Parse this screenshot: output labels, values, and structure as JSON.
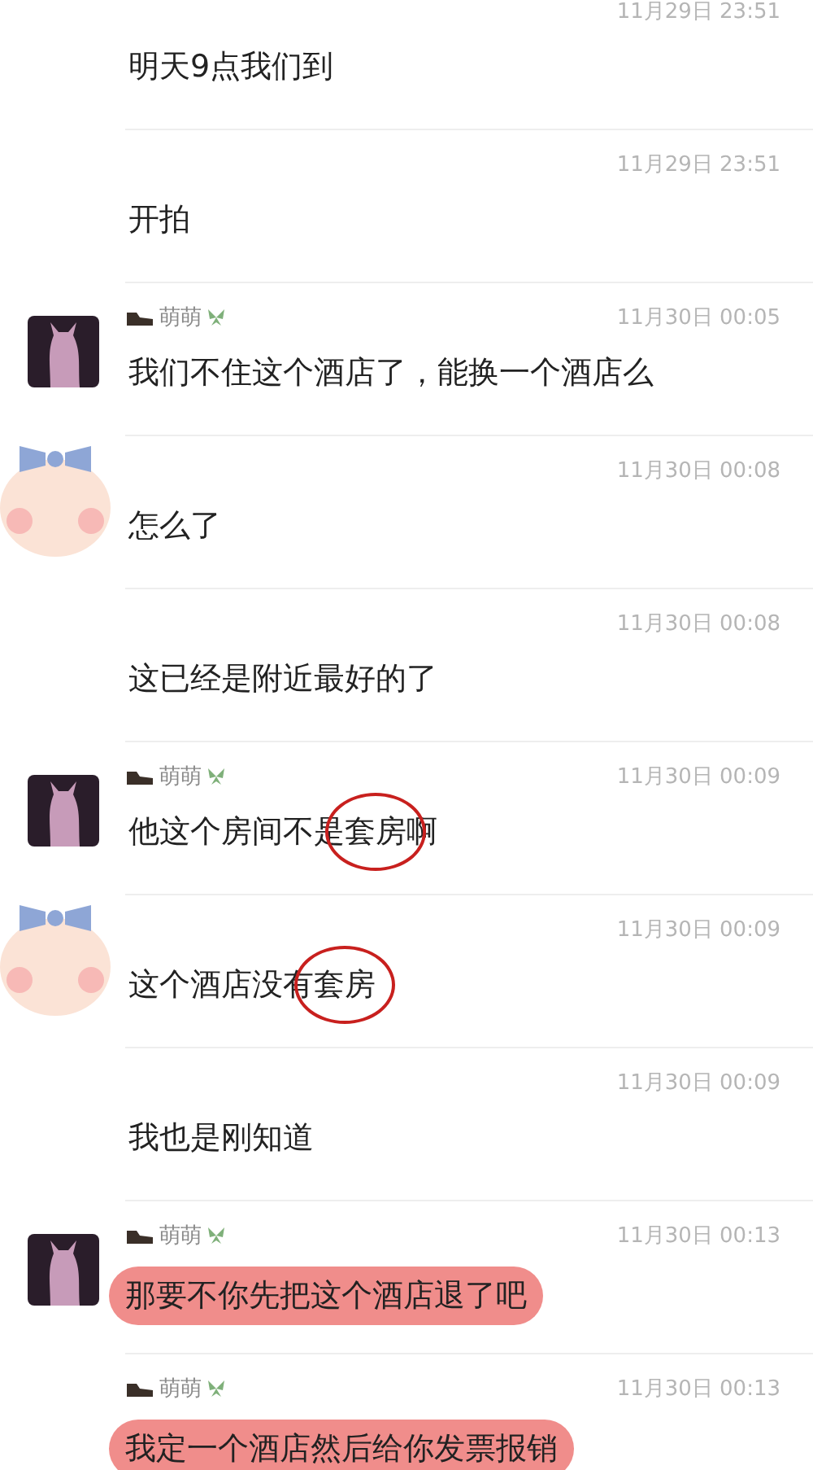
{
  "messages": [
    {
      "time": "11月29日 23:51",
      "highlighted": false,
      "segments": [
        {
          "text": "明天9点我们到",
          "circled": false
        }
      ]
    },
    {
      "time": "11月29日 23:51",
      "highlighted": false,
      "segments": [
        {
          "text": "开拍",
          "circled": false
        }
      ]
    },
    {
      "avatar": {
        "kind": "figure"
      },
      "name": "萌萌",
      "time": "11月30日 00:05",
      "highlighted": false,
      "segments": [
        {
          "text": "我们不住这个酒店了，能换一个酒店么",
          "circled": false
        }
      ]
    },
    {
      "avatar": {
        "kind": "bear"
      },
      "time": "11月30日 00:08",
      "highlighted": false,
      "segments": [
        {
          "text": "怎么了",
          "circled": false
        }
      ]
    },
    {
      "time": "11月30日 00:08",
      "highlighted": false,
      "segments": [
        {
          "text": "这已经是附近最好的了",
          "circled": false
        }
      ]
    },
    {
      "avatar": {
        "kind": "figure"
      },
      "name": "萌萌",
      "time": "11月30日 00:09",
      "highlighted": false,
      "segments": [
        {
          "text": "他这个房间不是",
          "circled": false
        },
        {
          "text": "套房",
          "circled": true
        },
        {
          "text": "啊",
          "circled": false
        }
      ]
    },
    {
      "avatar": {
        "kind": "bear"
      },
      "time": "11月30日 00:09",
      "highlighted": false,
      "segments": [
        {
          "text": "这个酒店没有",
          "circled": false
        },
        {
          "text": "套房",
          "circled": true
        }
      ]
    },
    {
      "time": "11月30日 00:09",
      "highlighted": false,
      "segments": [
        {
          "text": "我也是刚知道",
          "circled": false
        }
      ]
    },
    {
      "avatar": {
        "kind": "figure"
      },
      "name": "萌萌",
      "time": "11月30日 00:13",
      "highlighted": true,
      "segments": [
        {
          "text": "那要不你先把这个酒店退了吧",
          "circled": false
        }
      ]
    },
    {
      "name": "萌萌",
      "time": "11月30日 00:13",
      "highlighted": true,
      "segments": [
        {
          "text": "我定一个酒店然后给你发票报销",
          "circled": false
        }
      ]
    }
  ]
}
